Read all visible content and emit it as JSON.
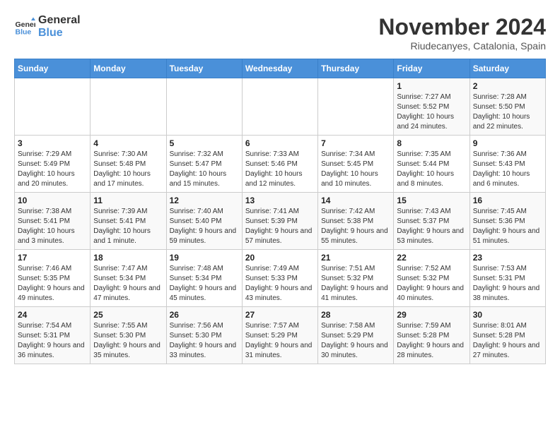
{
  "logo": {
    "line1": "General",
    "line2": "Blue"
  },
  "title": "November 2024",
  "subtitle": "Riudecanyes, Catalonia, Spain",
  "days_header": [
    "Sunday",
    "Monday",
    "Tuesday",
    "Wednesday",
    "Thursday",
    "Friday",
    "Saturday"
  ],
  "weeks": [
    [
      {
        "day": "",
        "detail": ""
      },
      {
        "day": "",
        "detail": ""
      },
      {
        "day": "",
        "detail": ""
      },
      {
        "day": "",
        "detail": ""
      },
      {
        "day": "",
        "detail": ""
      },
      {
        "day": "1",
        "detail": "Sunrise: 7:27 AM\nSunset: 5:52 PM\nDaylight: 10 hours and 24 minutes."
      },
      {
        "day": "2",
        "detail": "Sunrise: 7:28 AM\nSunset: 5:50 PM\nDaylight: 10 hours and 22 minutes."
      }
    ],
    [
      {
        "day": "3",
        "detail": "Sunrise: 7:29 AM\nSunset: 5:49 PM\nDaylight: 10 hours and 20 minutes."
      },
      {
        "day": "4",
        "detail": "Sunrise: 7:30 AM\nSunset: 5:48 PM\nDaylight: 10 hours and 17 minutes."
      },
      {
        "day": "5",
        "detail": "Sunrise: 7:32 AM\nSunset: 5:47 PM\nDaylight: 10 hours and 15 minutes."
      },
      {
        "day": "6",
        "detail": "Sunrise: 7:33 AM\nSunset: 5:46 PM\nDaylight: 10 hours and 12 minutes."
      },
      {
        "day": "7",
        "detail": "Sunrise: 7:34 AM\nSunset: 5:45 PM\nDaylight: 10 hours and 10 minutes."
      },
      {
        "day": "8",
        "detail": "Sunrise: 7:35 AM\nSunset: 5:44 PM\nDaylight: 10 hours and 8 minutes."
      },
      {
        "day": "9",
        "detail": "Sunrise: 7:36 AM\nSunset: 5:43 PM\nDaylight: 10 hours and 6 minutes."
      }
    ],
    [
      {
        "day": "10",
        "detail": "Sunrise: 7:38 AM\nSunset: 5:41 PM\nDaylight: 10 hours and 3 minutes."
      },
      {
        "day": "11",
        "detail": "Sunrise: 7:39 AM\nSunset: 5:41 PM\nDaylight: 10 hours and 1 minute."
      },
      {
        "day": "12",
        "detail": "Sunrise: 7:40 AM\nSunset: 5:40 PM\nDaylight: 9 hours and 59 minutes."
      },
      {
        "day": "13",
        "detail": "Sunrise: 7:41 AM\nSunset: 5:39 PM\nDaylight: 9 hours and 57 minutes."
      },
      {
        "day": "14",
        "detail": "Sunrise: 7:42 AM\nSunset: 5:38 PM\nDaylight: 9 hours and 55 minutes."
      },
      {
        "day": "15",
        "detail": "Sunrise: 7:43 AM\nSunset: 5:37 PM\nDaylight: 9 hours and 53 minutes."
      },
      {
        "day": "16",
        "detail": "Sunrise: 7:45 AM\nSunset: 5:36 PM\nDaylight: 9 hours and 51 minutes."
      }
    ],
    [
      {
        "day": "17",
        "detail": "Sunrise: 7:46 AM\nSunset: 5:35 PM\nDaylight: 9 hours and 49 minutes."
      },
      {
        "day": "18",
        "detail": "Sunrise: 7:47 AM\nSunset: 5:34 PM\nDaylight: 9 hours and 47 minutes."
      },
      {
        "day": "19",
        "detail": "Sunrise: 7:48 AM\nSunset: 5:34 PM\nDaylight: 9 hours and 45 minutes."
      },
      {
        "day": "20",
        "detail": "Sunrise: 7:49 AM\nSunset: 5:33 PM\nDaylight: 9 hours and 43 minutes."
      },
      {
        "day": "21",
        "detail": "Sunrise: 7:51 AM\nSunset: 5:32 PM\nDaylight: 9 hours and 41 minutes."
      },
      {
        "day": "22",
        "detail": "Sunrise: 7:52 AM\nSunset: 5:32 PM\nDaylight: 9 hours and 40 minutes."
      },
      {
        "day": "23",
        "detail": "Sunrise: 7:53 AM\nSunset: 5:31 PM\nDaylight: 9 hours and 38 minutes."
      }
    ],
    [
      {
        "day": "24",
        "detail": "Sunrise: 7:54 AM\nSunset: 5:31 PM\nDaylight: 9 hours and 36 minutes."
      },
      {
        "day": "25",
        "detail": "Sunrise: 7:55 AM\nSunset: 5:30 PM\nDaylight: 9 hours and 35 minutes."
      },
      {
        "day": "26",
        "detail": "Sunrise: 7:56 AM\nSunset: 5:30 PM\nDaylight: 9 hours and 33 minutes."
      },
      {
        "day": "27",
        "detail": "Sunrise: 7:57 AM\nSunset: 5:29 PM\nDaylight: 9 hours and 31 minutes."
      },
      {
        "day": "28",
        "detail": "Sunrise: 7:58 AM\nSunset: 5:29 PM\nDaylight: 9 hours and 30 minutes."
      },
      {
        "day": "29",
        "detail": "Sunrise: 7:59 AM\nSunset: 5:28 PM\nDaylight: 9 hours and 28 minutes."
      },
      {
        "day": "30",
        "detail": "Sunrise: 8:01 AM\nSunset: 5:28 PM\nDaylight: 9 hours and 27 minutes."
      }
    ]
  ]
}
